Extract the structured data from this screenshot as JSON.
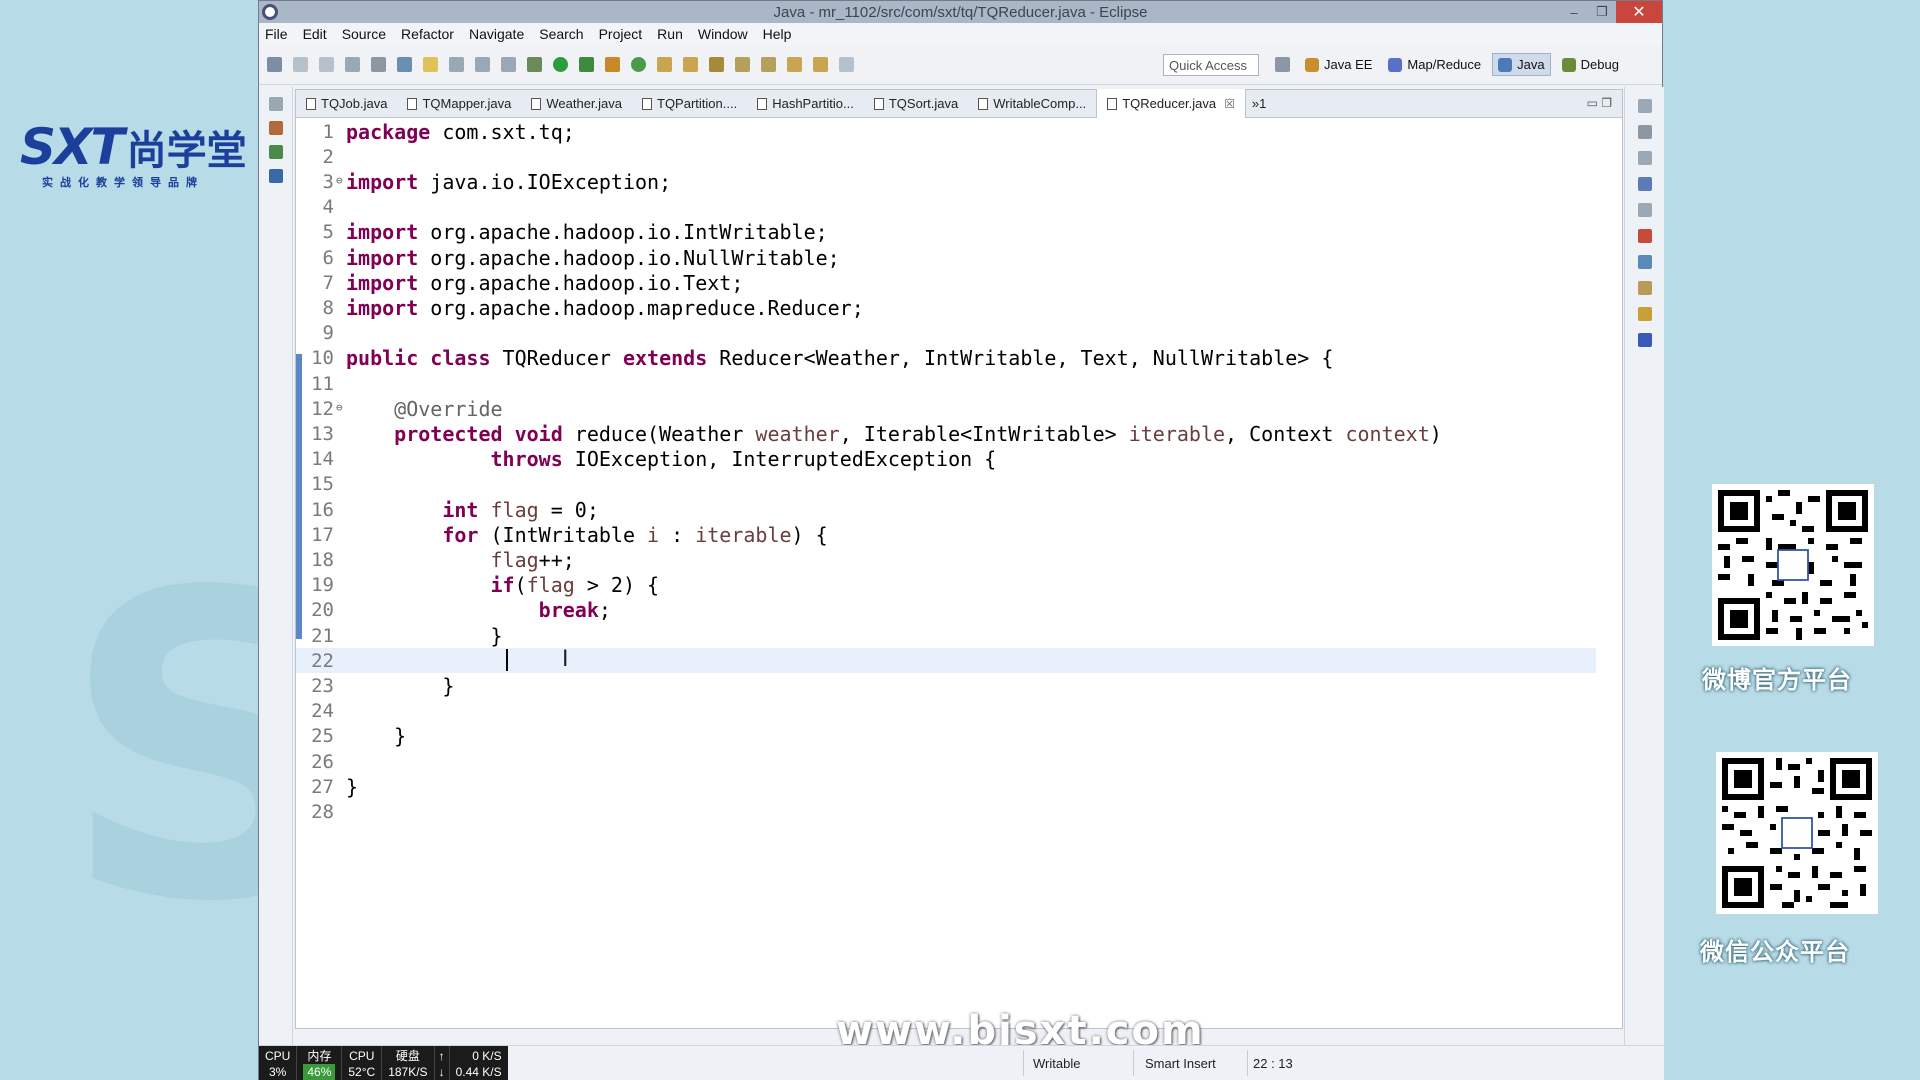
{
  "window": {
    "title": "Java - mr_1102/src/com/sxt/tq/TQReducer.java - Eclipse"
  },
  "window_controls": {
    "minimize": "–",
    "maximize": "❐",
    "close": "✕"
  },
  "menu": [
    "File",
    "Edit",
    "Source",
    "Refactor",
    "Navigate",
    "Search",
    "Project",
    "Run",
    "Window",
    "Help"
  ],
  "toolbar": {
    "quick_access": "Quick Access"
  },
  "perspectives": [
    {
      "label": "Java EE",
      "color": "#c8902c"
    },
    {
      "label": "Map/Reduce",
      "color": "#5b6fc8"
    },
    {
      "label": "Java",
      "color": "#4a7bb8",
      "active": true
    },
    {
      "label": "Debug",
      "color": "#6b8a3a"
    }
  ],
  "tabs": [
    {
      "label": "TQJob.java"
    },
    {
      "label": "TQMapper.java"
    },
    {
      "label": "Weather.java"
    },
    {
      "label": "TQPartition...."
    },
    {
      "label": "HashPartitio..."
    },
    {
      "label": "TQSort.java"
    },
    {
      "label": "WritableComp..."
    },
    {
      "label": "TQReducer.java",
      "active": true
    }
  ],
  "tab_overflow": "»1",
  "code_lines": [
    "package com.sxt.tq;",
    "",
    "import java.io.IOException;",
    "",
    "import org.apache.hadoop.io.IntWritable;",
    "import org.apache.hadoop.io.NullWritable;",
    "import org.apache.hadoop.io.Text;",
    "import org.apache.hadoop.mapreduce.Reducer;",
    "",
    "public class TQReducer extends Reducer<Weather, IntWritable, Text, NullWritable> {",
    "",
    "    @Override",
    "    protected void reduce(Weather weather, Iterable<IntWritable> iterable, Context context)",
    "            throws IOException, InterruptedException {",
    "",
    "        int flag = 0;",
    "        for (IntWritable i : iterable) {",
    "            flag++;",
    "            if(flag > 2) {",
    "                break;",
    "            }",
    "            ",
    "        }",
    "",
    "    }",
    "",
    "}",
    ""
  ],
  "current_line": 22,
  "status": {
    "writable": "Writable",
    "insert_mode": "Smart Insert",
    "position": "22 : 13"
  },
  "sys_monitor": {
    "cpu_label": "CPU",
    "cpu_value": "3%",
    "mem_label": "内存",
    "mem_value": "46%",
    "temp_label": "CPU",
    "temp_value": "52°C",
    "disk_label": "硬盘",
    "disk_value": "187K/S",
    "up_arrow": "↑",
    "down_arrow": "↓",
    "up_speed": "0 K/S",
    "down_speed": "0.44 K/S"
  },
  "brand": {
    "logo": "SXT",
    "name_cn": "尚学堂",
    "tagline": "实战化教学领导品牌"
  },
  "qr_labels": {
    "weibo": "微博官方平台",
    "wechat": "微信公众平台"
  },
  "watermark": "www.bjsxt.com"
}
